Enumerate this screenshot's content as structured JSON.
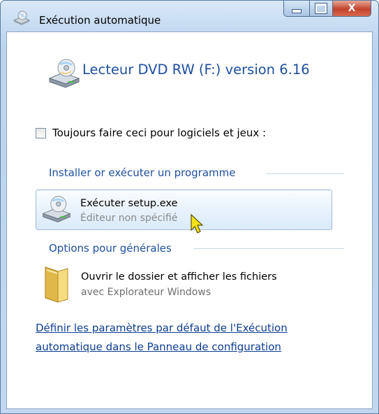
{
  "window": {
    "title": "Exécution automatique",
    "minimize_icon": "minimize-icon",
    "maximize_icon": "maximize-icon",
    "close_glyph": "X"
  },
  "drive": {
    "title": "Lecteur DVD RW (F:) version 6.16",
    "icon": "dvd-drive-icon"
  },
  "always_checkbox": {
    "label": "Toujours faire ceci pour logiciels et jeux :",
    "checked": false
  },
  "install_group": {
    "heading": "Installer or exécuter un programme",
    "items": [
      {
        "title": "Exécuter setup.exe",
        "subtitle": "Éditeur non spécifié",
        "icon": "dvd-drive-icon"
      }
    ]
  },
  "general_group": {
    "heading": "Options pour générales",
    "items": [
      {
        "title": "Ouvrir le dossier et afficher les fichiers",
        "subtitle": "avec Explorateur Windows",
        "icon": "folder-icon"
      }
    ]
  },
  "footer_link": {
    "line1": "Définir les paramètres par défaut de l'Exécution",
    "line2": "automatique dans le Panneau de configuration"
  },
  "colors": {
    "heading_blue": "#1e4f9e",
    "link_blue": "#0b3d91",
    "frame": "#c3d8f0"
  }
}
